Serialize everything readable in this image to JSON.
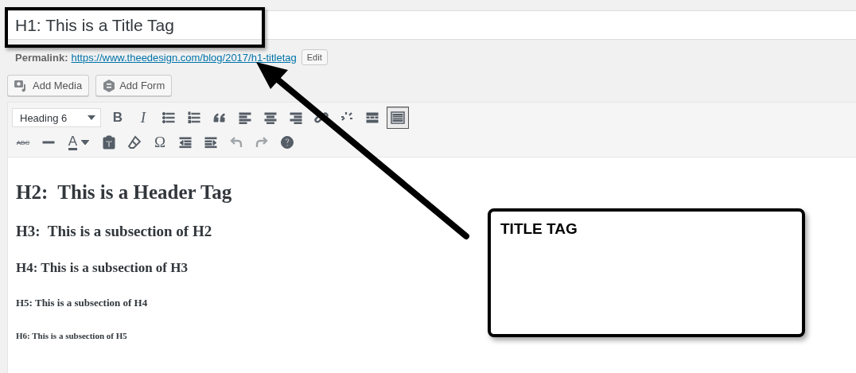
{
  "title_field": {
    "value": "H1: This is a Title Tag"
  },
  "permalink": {
    "label": "Permalink:",
    "url": "https://www.theedesign.com/blog/2017/h1-titletag",
    "edit_button": "Edit"
  },
  "media_buttons": [
    {
      "kind": "media",
      "label": "Add Media"
    },
    {
      "kind": "form",
      "label": "Add Form"
    }
  ],
  "toolbar": {
    "format_select": "Heading 6",
    "rows": [
      [
        {
          "kind": "bold",
          "label": "B",
          "pressed": false,
          "disabled": false
        },
        {
          "kind": "italic",
          "label": "I",
          "pressed": false,
          "disabled": false
        },
        {
          "kind": "bullets",
          "pressed": false,
          "disabled": false
        },
        {
          "kind": "numbers",
          "pressed": false,
          "disabled": false
        },
        {
          "kind": "quote",
          "pressed": false,
          "disabled": false
        },
        {
          "kind": "align-left",
          "pressed": false,
          "disabled": false
        },
        {
          "kind": "align-center",
          "pressed": false,
          "disabled": false
        },
        {
          "kind": "align-right",
          "pressed": false,
          "disabled": false
        },
        {
          "kind": "link",
          "pressed": false,
          "disabled": false
        },
        {
          "kind": "unlink",
          "pressed": false,
          "disabled": false
        },
        {
          "kind": "more",
          "pressed": false,
          "disabled": false
        },
        {
          "kind": "toolbar-toggle",
          "pressed": true,
          "disabled": false
        }
      ],
      [
        {
          "kind": "strike",
          "label": "ABC",
          "pressed": false,
          "disabled": false
        },
        {
          "kind": "hr",
          "pressed": false,
          "disabled": false
        },
        {
          "kind": "text-color",
          "label": "A",
          "pressed": false,
          "disabled": false
        },
        {
          "kind": "paste",
          "pressed": false,
          "disabled": false
        },
        {
          "kind": "eraser",
          "pressed": false,
          "disabled": false
        },
        {
          "kind": "omega",
          "label": "Ω",
          "pressed": false,
          "disabled": false
        },
        {
          "kind": "outdent",
          "pressed": false,
          "disabled": false
        },
        {
          "kind": "indent",
          "pressed": false,
          "disabled": false
        },
        {
          "kind": "undo",
          "pressed": false,
          "disabled": true
        },
        {
          "kind": "redo",
          "pressed": false,
          "disabled": true
        },
        {
          "kind": "help",
          "pressed": false,
          "disabled": false
        }
      ]
    ]
  },
  "content": [
    {
      "kind": "h2",
      "text": "H2:  This is a Header Tag"
    },
    {
      "kind": "h3",
      "text": "H3:  This is a subsection of H2"
    },
    {
      "kind": "h4",
      "text": "H4: This is a subsection of H3"
    },
    {
      "kind": "h5",
      "text": "H5: This is a subsection of H4"
    },
    {
      "kind": "h6",
      "text": "H6: This is a subsection of H5"
    }
  ],
  "annotation": {
    "label": "TITLE TAG"
  }
}
